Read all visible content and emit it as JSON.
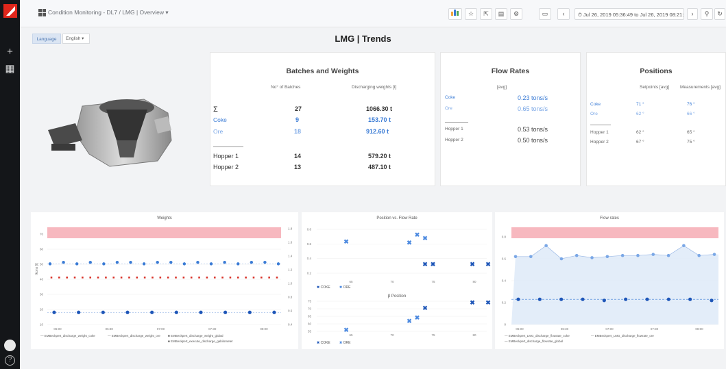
{
  "app": {
    "breadcrumb": "Condition Monitoring - DL7 / LMG | Overview ▾",
    "time_range": "⏱ Jul 26, 2019 05:36:49 to Jul 26, 2019 08:21:55",
    "toolbar": [
      "add-panel-icon",
      "star-icon",
      "share-icon",
      "save-icon",
      "gear-icon",
      "tv-icon"
    ],
    "variables": {
      "label": "Language",
      "value": "English ▾"
    },
    "page_title": "LMG | Trends"
  },
  "colors": {
    "accent": "#3a7bd5",
    "threshold": "#f7b8bf",
    "area": "#dce8f8",
    "sidebar": "#141619"
  },
  "batches": {
    "title": "Batches and Weights",
    "col1": "No° of Batches",
    "col2": "Discharging weights [t]",
    "rows": [
      {
        "label": "Σ",
        "count": "27",
        "weight": "1066.30 t",
        "style": "normal"
      },
      {
        "label": "Coke",
        "count": "9",
        "weight": "153.70 t",
        "style": "blue"
      },
      {
        "label": "Ore",
        "count": "18",
        "weight": "912.60 t",
        "style": "blue"
      },
      {
        "label": "Hopper 1",
        "count": "14",
        "weight": "579.20 t",
        "style": "normal"
      },
      {
        "label": "Hopper 2",
        "count": "13",
        "weight": "487.10 t",
        "style": "normal"
      }
    ]
  },
  "flow": {
    "title": "Flow Rates",
    "col": "[avg]",
    "rows": [
      {
        "label": "Coke",
        "value": "0.23 tons/s",
        "style": "blue"
      },
      {
        "label": "Ore",
        "value": "0.65 tons/s",
        "style": "lightblue"
      },
      {
        "label": "Hopper 1",
        "value": "0.53 tons/s",
        "style": "normal"
      },
      {
        "label": "Hopper 2",
        "value": "0.50 tons/s",
        "style": "normal"
      }
    ]
  },
  "positions": {
    "title": "Positions",
    "col1": "Setpoints [avg]",
    "col2": "Measurements [avg]",
    "rows": [
      {
        "label": "Coke",
        "sp": "71 °",
        "ms": "76 °",
        "style": "blue"
      },
      {
        "label": "Ore",
        "sp": "62 °",
        "ms": "66 °",
        "style": "lightblue"
      },
      {
        "label": "Hopper 1",
        "sp": "62 °",
        "ms": "65 °",
        "style": "normal"
      },
      {
        "label": "Hopper 2",
        "sp": "67 °",
        "ms": "75 °",
        "style": "normal"
      }
    ]
  },
  "charts": {
    "weights": {
      "title": "Weights",
      "ylabel": "Ikons [t]",
      "y_ticks": [
        "70",
        "60",
        "50",
        "40",
        "30",
        "20",
        "10"
      ],
      "y2_ticks": [
        "1.8",
        "1.6",
        "1.4",
        "1.2",
        "1.0",
        "0.8",
        "0.6",
        "0.4"
      ],
      "x_ticks": [
        "06:00",
        "06:30",
        "07:00",
        "07:30",
        "08:00"
      ],
      "legend": [
        "— EMBeckpert_discharge_weight_coke",
        "— EMBeckpert_discharge_weight_ore",
        "■ EMBeckpert_discharge_weight_global",
        "■ EMBeckpert_execute_discharge_gabilometer"
      ]
    },
    "position_flow": {
      "title": "Position vs. Flow Rate",
      "y_ticks": [
        "0.8",
        "0.6",
        "0.4",
        "0.2"
      ],
      "x_ticks": [
        "65",
        "70",
        "75",
        "80"
      ],
      "legend": [
        "COKE",
        "ORE"
      ],
      "sub_title": "β Position",
      "y2_ticks": [
        "75",
        "70",
        "65",
        "60",
        "55"
      ],
      "x2_ticks": [
        "65",
        "70",
        "75",
        "80"
      ]
    },
    "flow_rates": {
      "title": "Flow rates",
      "y_ticks": [
        "0.8",
        "0.6",
        "0.4",
        "0.2",
        "0"
      ],
      "x_ticks": [
        "06:00",
        "06:30",
        "07:00",
        "07:30",
        "08:00"
      ],
      "legend": [
        "— EMBeckpert_LMG_discharge_flowrate_coke",
        "— EMBeckpert_LMG_discharge_flowrate_ore",
        "— EMBeckpert_discharge_flowrate_global"
      ]
    }
  },
  "chart_data": [
    {
      "type": "line",
      "title": "Weights",
      "x": [
        "06:00",
        "06:30",
        "07:00",
        "07:30",
        "08:00"
      ],
      "ylabel": "Ikons [t]",
      "ylim": [
        10,
        75
      ],
      "series": [
        {
          "name": "EMBeckpert_discharge_weight_coke",
          "values": [
            18,
            18,
            18,
            18,
            18,
            18,
            18,
            18,
            18,
            18
          ]
        },
        {
          "name": "EMBeckpert_discharge_weight_ore",
          "values": [
            50,
            51,
            50,
            51,
            50,
            51,
            51,
            50,
            51,
            51
          ]
        },
        {
          "name": "EMBeckpert_discharge_weight_global",
          "values": [
            41,
            41,
            41,
            41,
            41,
            41,
            41,
            41,
            41,
            41
          ]
        }
      ]
    },
    {
      "type": "scatter",
      "title": "Position vs. Flow Rate",
      "series": [
        {
          "name": "COKE",
          "points": [
            [
              72,
              0.22
            ],
            [
              78,
              0.22
            ],
            [
              80,
              0.22
            ],
            [
              73,
              0.22
            ]
          ]
        },
        {
          "name": "ORE",
          "points": [
            [
              62,
              0.62
            ],
            [
              70,
              0.6
            ],
            [
              71,
              0.74
            ],
            [
              72,
              0.68
            ]
          ]
        }
      ]
    },
    {
      "type": "area",
      "title": "Flow rates",
      "x": [
        "06:00",
        "06:30",
        "07:00",
        "07:30",
        "08:00"
      ],
      "ylim": [
        0,
        0.9
      ],
      "series": [
        {
          "name": "EMBeckpert_LMG_discharge_flowrate_ore",
          "values": [
            0.62,
            0.62,
            0.72,
            0.6,
            0.63,
            0.61,
            0.62,
            0.63,
            0.63,
            0.64,
            0.63,
            0.72,
            0.63,
            0.64
          ]
        },
        {
          "name": "EMBeckpert_LMG_discharge_flowrate_coke",
          "values": [
            0.23,
            0.23,
            0.23,
            0.23,
            0.22,
            0.23,
            0.23,
            0.23,
            0.23,
            0.22
          ]
        }
      ]
    }
  ]
}
